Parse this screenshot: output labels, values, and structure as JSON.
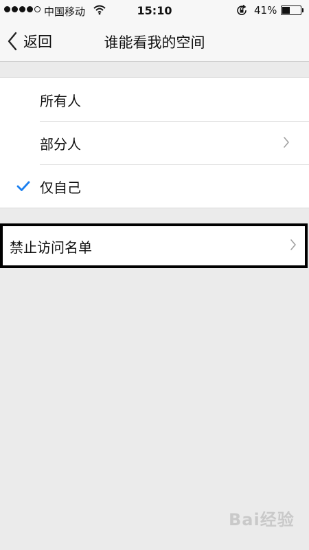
{
  "status_bar": {
    "signal_filled": 4,
    "signal_total": 5,
    "carrier": "中国移动",
    "time": "15:10",
    "battery_percent_text": "41%",
    "battery_level": 0.41,
    "icons": [
      "signal-dots",
      "wifi-icon",
      "rotation-lock-icon",
      "battery-icon"
    ]
  },
  "nav": {
    "back_label": "返回",
    "title": "谁能看我的空间",
    "back_icon": "chevron-left-icon"
  },
  "options": [
    {
      "label": "所有人",
      "selected": false,
      "has_chevron": false
    },
    {
      "label": "部分人",
      "selected": false,
      "has_chevron": true
    },
    {
      "label": "仅自己",
      "selected": true,
      "has_chevron": false
    }
  ],
  "blocked_list": {
    "label": "禁止访问名单",
    "has_chevron": true
  },
  "watermark": "Bai经验",
  "colors": {
    "accent": "#1a7ff0",
    "background": "#ebebeb",
    "bar": "#f7f7f7",
    "cell": "#ffffff",
    "chevron": "#a0a0a0"
  }
}
